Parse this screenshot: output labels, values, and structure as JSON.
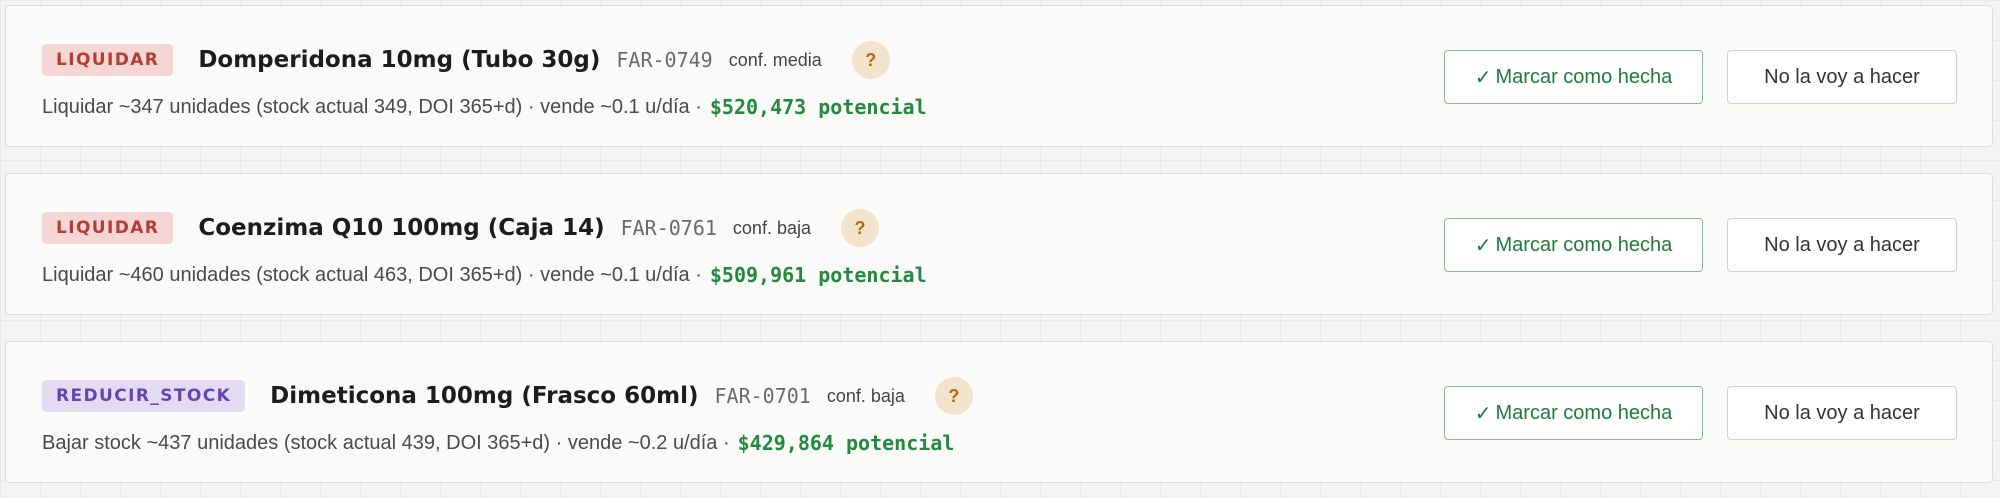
{
  "actions": [
    {
      "tag": "LIQUIDAR",
      "tag_color": "#b43c34",
      "product": "Domperidona 10mg (Tubo 30g)",
      "sku": "FAR-0749",
      "confidence": "conf. media",
      "help": "?",
      "detail": "Liquidar ~347 unidades (stock actual 349, DOI 365+d) · vende ~0.1 u/día ·",
      "potential": "$520,473 potencial",
      "done_label": "Marcar como hecha",
      "skip_label": "No la voy a hacer"
    },
    {
      "tag": "LIQUIDAR",
      "tag_color": "#b43c34",
      "product": "Coenzima Q10 100mg (Caja 14)",
      "sku": "FAR-0761",
      "confidence": "conf. baja",
      "help": "?",
      "detail": "Liquidar ~460 unidades (stock actual 463, DOI 365+d) · vende ~0.1 u/día ·",
      "potential": "$509,961 potencial",
      "done_label": "Marcar como hecha",
      "skip_label": "No la voy a hacer"
    },
    {
      "tag": "REDUCIR_STOCK",
      "tag_color": "#6645b0",
      "product": "Dimeticona 100mg (Frasco 60ml)",
      "sku": "FAR-0701",
      "confidence": "conf. baja",
      "help": "?",
      "detail": "Bajar stock ~437 unidades (stock actual 439, DOI 365+d) · vende ~0.2 u/día ·",
      "potential": "$429,864 potencial",
      "done_label": "Marcar como hecha",
      "skip_label": "No la voy a hacer"
    }
  ],
  "icons": {
    "check": "check-icon",
    "help": "question-icon"
  },
  "colors": {
    "money": "#218a3c",
    "done_border": "#7cc191",
    "help_bg": "#f2e3cc",
    "help_fg": "#b5670f"
  }
}
